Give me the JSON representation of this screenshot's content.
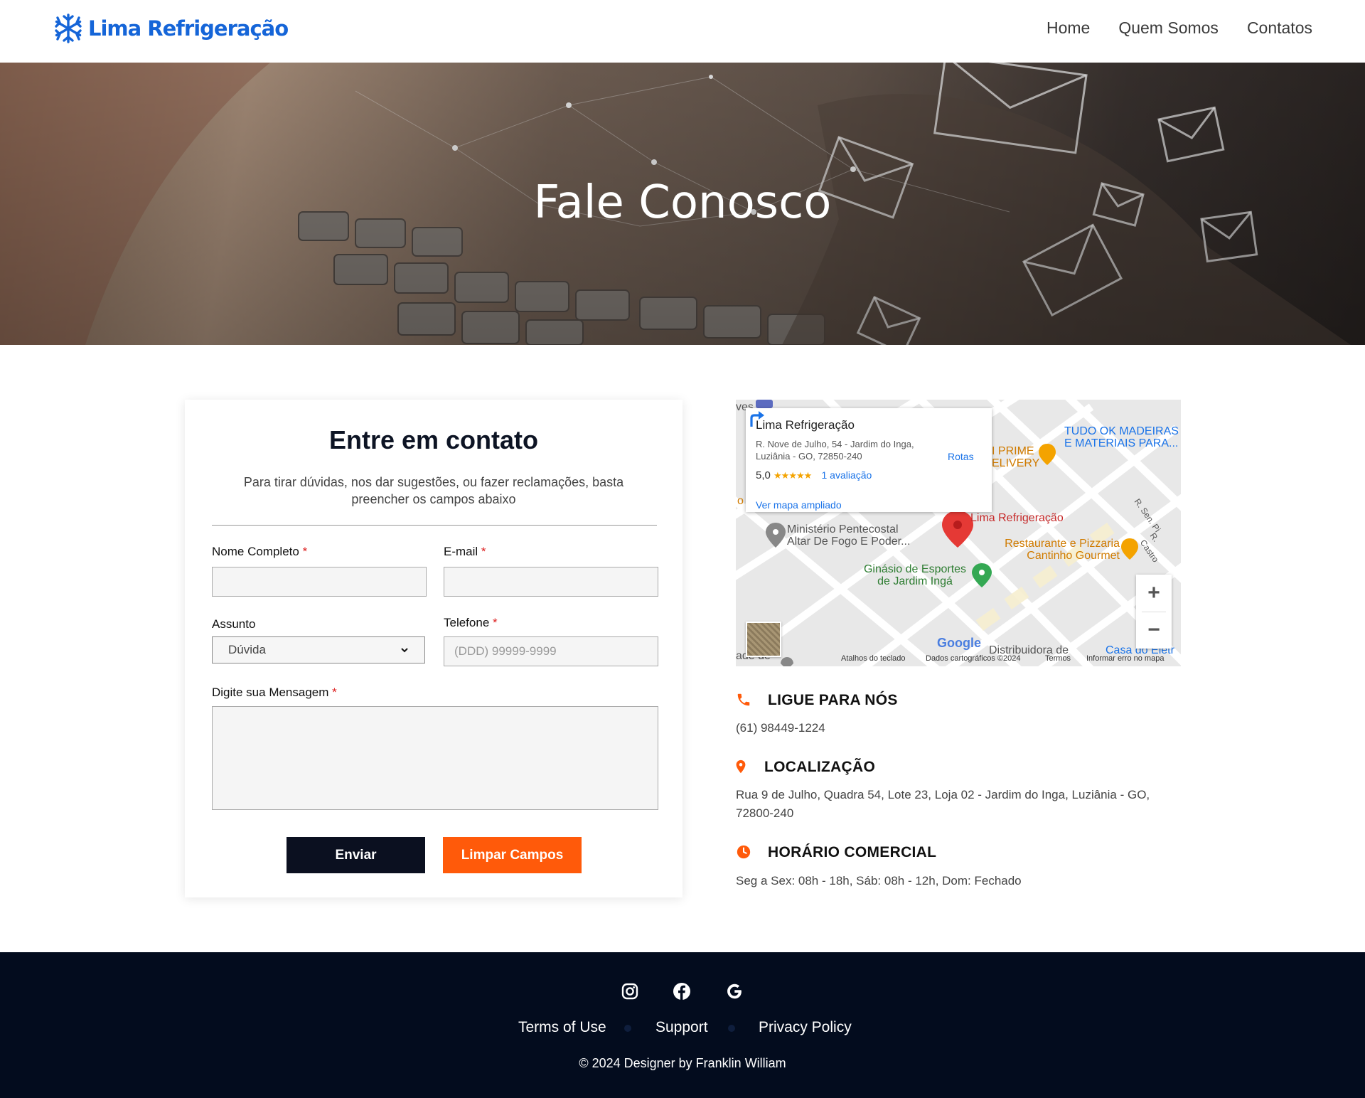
{
  "header": {
    "logo_text": "Lima Refrigeração",
    "nav": [
      "Home",
      "Quem Somos",
      "Contatos"
    ]
  },
  "hero": {
    "title": "Fale Conosco"
  },
  "form": {
    "title": "Entre em contato",
    "subtitle": "Para tirar dúvidas, nos dar sugestões, ou fazer reclamações, basta preencher os campos abaixo",
    "name_label": "Nome Completo",
    "email_label": "E-mail",
    "subject_label": "Assunto",
    "subject_value": "Dúvida",
    "phone_label": "Telefone",
    "phone_placeholder": "(DDD) 99999-9999",
    "message_label": "Digite sua Mensagem",
    "required_mark": "*",
    "submit_label": "Enviar",
    "clear_label": "Limpar Campos"
  },
  "map": {
    "place_name": "Lima Refrigeração",
    "address": "R. Nove de Julho, 54 - Jardim do Inga, Luziânia - GO, 72850-240",
    "rating": "5,0",
    "stars": "★★★★★",
    "reviews": "1 avaliação",
    "larger_map": "Ver mapa ampliado",
    "directions": "Rotas",
    "labels": {
      "tudo_ok": "TUDO OK MADEIRAS E MATERIAIS PARA...",
      "prime": "I PRIME ELIVERY",
      "ministerio": "Ministério Pentecostal Altar De Fogo E Poder...",
      "lima_pin": "Lima Refrigeração",
      "restaurante": "Restaurante e Pizzaria Cantinho Gourmet",
      "ginasio": "Ginásio de Esportes de Jardim Ingá",
      "distribuidora": "Distribuidora de",
      "casa": "Casa do Eletr",
      "r_sen": "R. Sen. Pi",
      "r_castro": "R. Castro",
      "ves": "ves",
      "ade": "ade de",
      "o": "o"
    },
    "google": "Google",
    "attribution": [
      "Atalhos do teclado",
      "Dados cartográficos ©2024",
      "Termos",
      "Informar erro no mapa"
    ],
    "zoom_in": "+",
    "zoom_out": "−"
  },
  "contact": {
    "phone_title": "LIGUE PARA NÓS",
    "phone": "(61) 98449-1224",
    "location_title": "LOCALIZAÇÃO",
    "location": "Rua 9 de Julho, Quadra 54, Lote 23, Loja 02 - Jardim do Inga, Luziânia - GO, 72800-240",
    "hours_title": "HORÁRIO COMERCIAL",
    "hours": "Seg a Sex: 08h - 18h, Sáb: 08h - 12h, Dom: Fechado"
  },
  "footer": {
    "links": [
      "Terms of Use",
      "Support",
      "Privacy Policy"
    ],
    "copyright": "© 2024 Designer by Franklin William"
  },
  "colors": {
    "brand_blue": "#1565d8",
    "accent_orange": "#ff5a0a",
    "dark_navy": "#030c1e"
  },
  "icons": [
    "snowflake-icon",
    "phone-icon",
    "location-pin-icon",
    "clock-icon",
    "instagram-icon",
    "facebook-icon",
    "google-icon",
    "directions-icon",
    "chevron-down-icon"
  ]
}
